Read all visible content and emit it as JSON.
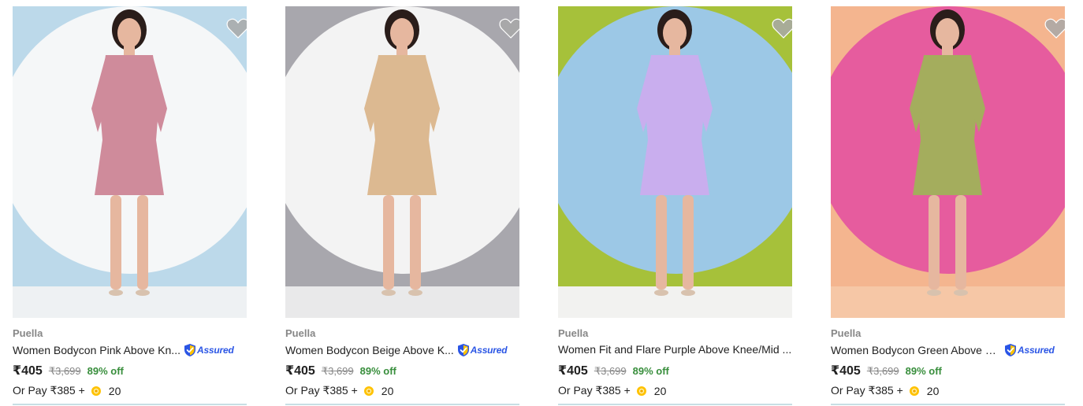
{
  "products": [
    {
      "brand": "Puella",
      "title": "Women Bodycon Pink Above Kn...",
      "assured": true,
      "assured_label": "Assured",
      "price": "₹405",
      "mrp": "₹3,699",
      "discount": "89% off",
      "pay_prefix": "Or Pay ₹385 +",
      "coins": "20",
      "image_alt": "Woman in pink bodycon dress",
      "colors": {
        "bg": "#bcd9ea",
        "dress": "#cf8b9b",
        "accent": "#f5f7f8",
        "floor": "#eef1f3"
      }
    },
    {
      "brand": "Puella",
      "title": "Women Bodycon Beige Above K...",
      "assured": true,
      "assured_label": "Assured",
      "price": "₹405",
      "mrp": "₹3,699",
      "discount": "89% off",
      "pay_prefix": "Or Pay ₹385 +",
      "coins": "20",
      "image_alt": "Woman in beige bodycon dress",
      "colors": {
        "bg": "#a8a7ad",
        "dress": "#dcb991",
        "accent": "#f3f3f3",
        "floor": "#e9e9ea"
      }
    },
    {
      "brand": "Puella",
      "title": "Women Fit and Flare Purple Above Knee/Mid ...",
      "assured": false,
      "assured_label": "",
      "price": "₹405",
      "mrp": "₹3,699",
      "discount": "89% off",
      "pay_prefix": "Or Pay ₹385 +",
      "coins": "20",
      "image_alt": "Woman in purple fit and flare dress",
      "colors": {
        "bg": "#a6c13a",
        "dress": "#c9aeee",
        "accent": "#9cc8e6",
        "floor": "#f2f2f0"
      }
    },
    {
      "brand": "Puella",
      "title": "Women Bodycon Green Above K...",
      "assured": true,
      "assured_label": "Assured",
      "price": "₹405",
      "mrp": "₹3,699",
      "discount": "89% off",
      "pay_prefix": "Or Pay ₹385 +",
      "coins": "20",
      "image_alt": "Woman in green bodycon dress",
      "colors": {
        "bg": "#f4b58f",
        "dress": "#a4ad5d",
        "accent": "#e65c9e",
        "floor": "#f6c7a6"
      }
    }
  ],
  "icons": {
    "wishlist": "heart-icon",
    "assured": "shield-check-icon",
    "coin": "supercoin-icon"
  },
  "theme": {
    "discount_color": "#388e3c",
    "assured_color": "#2a55e5",
    "muted_text": "#878787",
    "coin_color": "#ffc200",
    "wishlist_color": "#c2c2c2"
  }
}
